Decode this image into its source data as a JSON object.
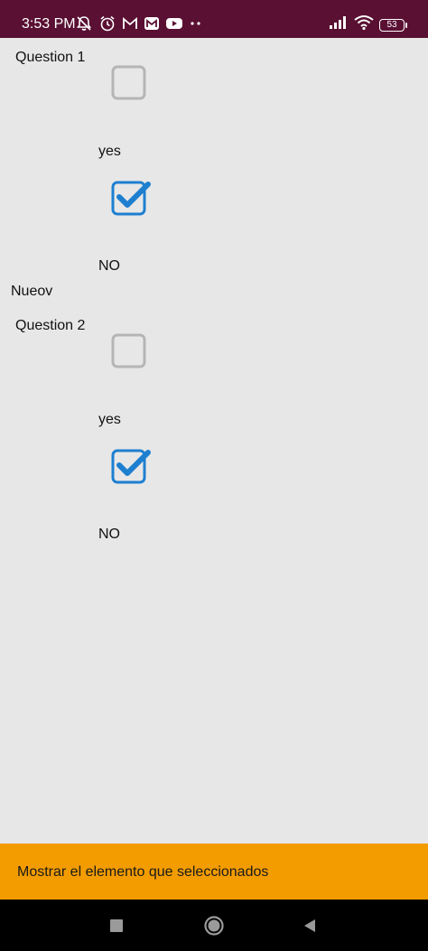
{
  "status_bar": {
    "time": "3:53 PM",
    "battery": "53",
    "icons": [
      "muted-notification-icon",
      "alarm-icon",
      "gmail-icon",
      "mi-icon",
      "youtube-icon",
      "more-dots-icon",
      "signal-icon",
      "wifi-icon",
      "battery-icon"
    ]
  },
  "questions": [
    {
      "title": "Question 1",
      "options": [
        {
          "label": "yes",
          "checked": false
        },
        {
          "label": "NO",
          "checked": true
        }
      ]
    },
    {
      "title": "Question 2",
      "options": [
        {
          "label": "yes",
          "checked": false
        },
        {
          "label": "NO",
          "checked": true
        }
      ]
    }
  ],
  "separator_text": "Nueov",
  "action_button": {
    "label": "Mostrar el elemento que seleccionados"
  },
  "nav": {
    "icons": [
      "recents-square-icon",
      "home-circle-icon",
      "back-triangle-icon"
    ]
  },
  "colors": {
    "status_bar": "#5a1033",
    "background": "#e7e7e7",
    "checkbox_checked": "#1e7fd0",
    "checkbox_unchecked": "#b5b5b5",
    "action_bar": "#f39c00"
  }
}
